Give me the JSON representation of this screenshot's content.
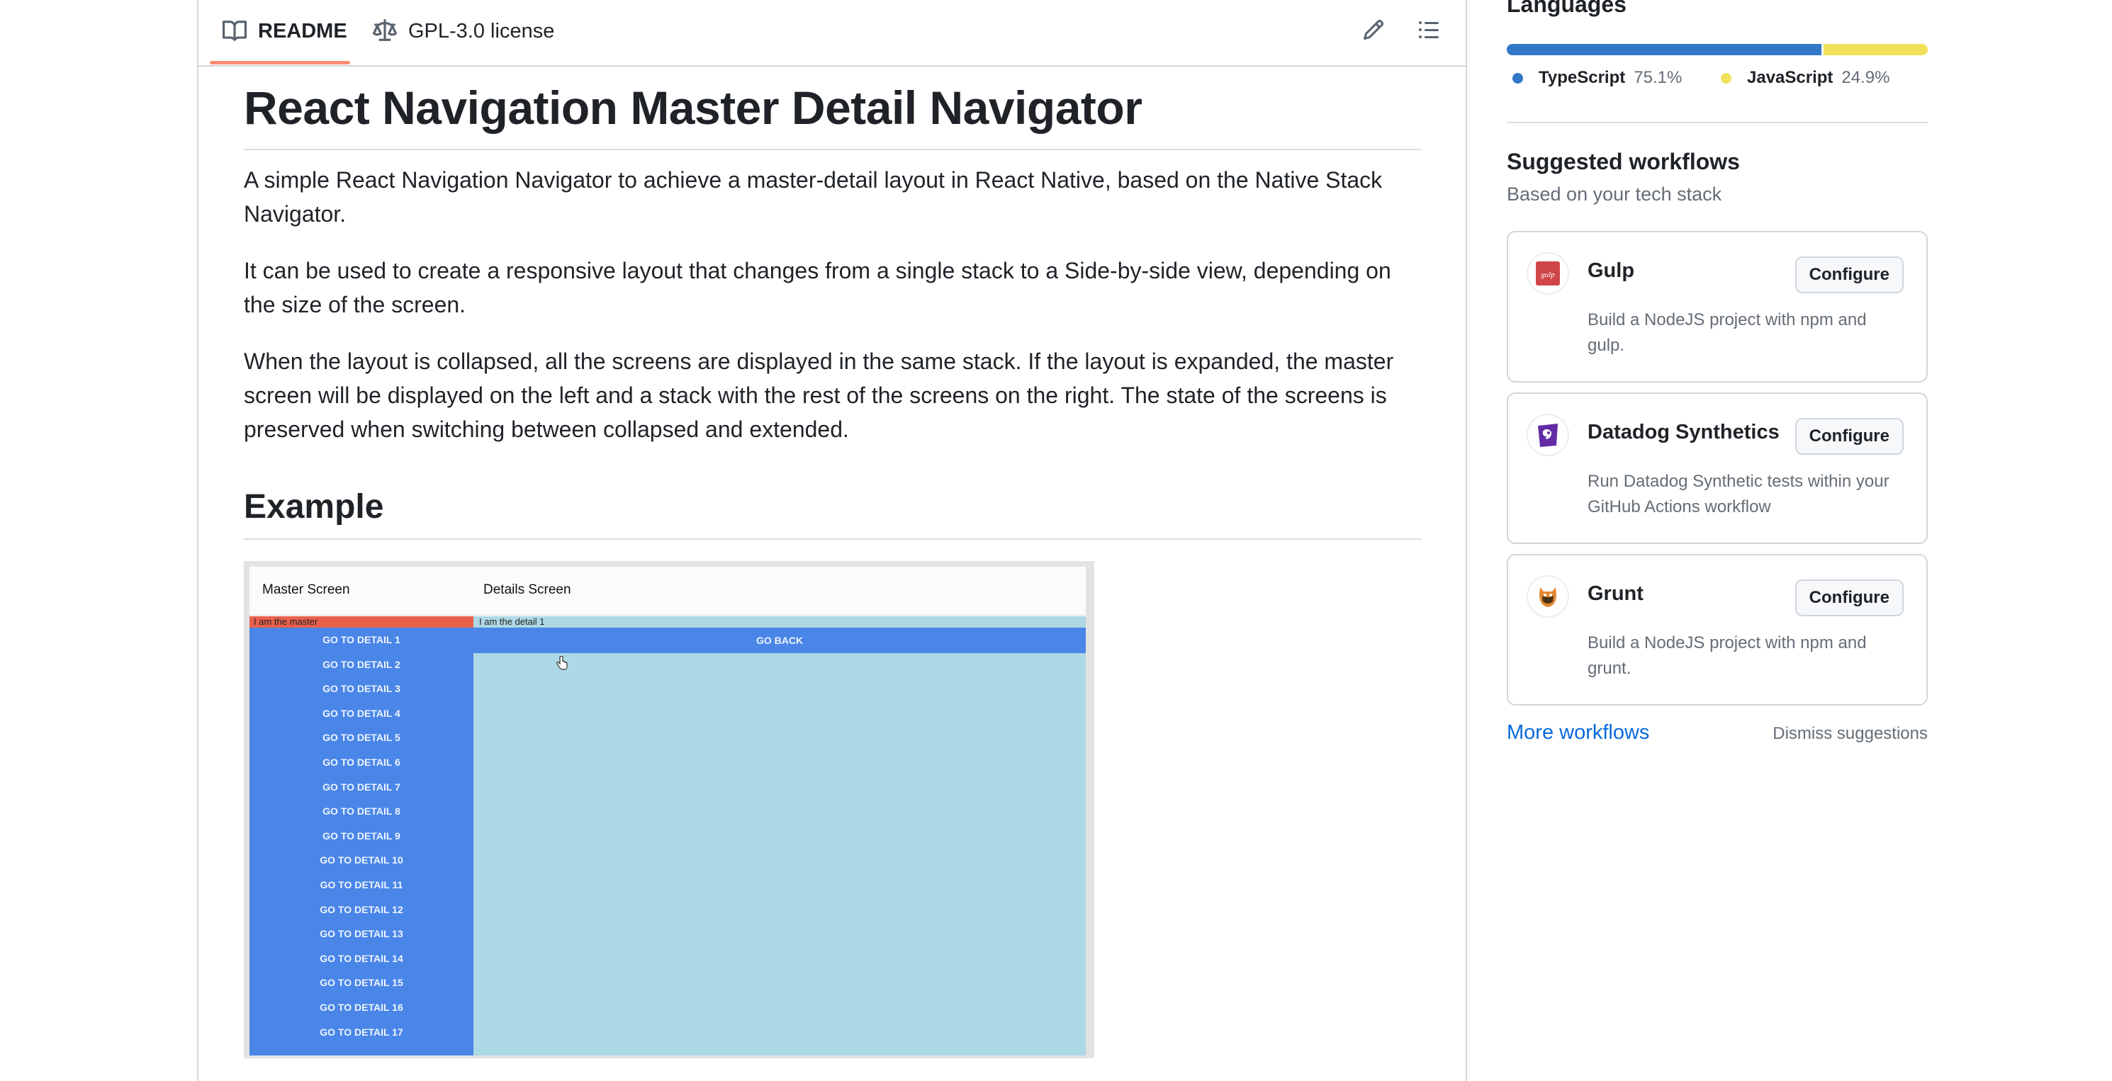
{
  "tabs": [
    {
      "label": "README",
      "icon": "book-icon",
      "active": true
    },
    {
      "label": "GPL-3.0 license",
      "icon": "scale-icon",
      "active": false
    }
  ],
  "toolbar": {
    "edit_icon": "pencil-icon",
    "toc_icon": "list-icon"
  },
  "readme": {
    "title": "React Navigation Master Detail Navigator",
    "paragraphs": [
      "A simple React Navigation Navigator to achieve a master-detail layout in React Native, based on the Native Stack Navigator.",
      "It can be used to create a responsive layout that changes from a single stack to a Side-by-side view, depending on the size of the screen.",
      "When the layout is collapsed, all the screens are displayed in the same stack. If the layout is expanded, the master screen will be displayed on the left and a stack with the rest of the screens on the right. The state of the screens is preserved when switching between collapsed and extended."
    ],
    "example_heading": "Example",
    "demo": {
      "master_header": "Master Screen",
      "details_header": "Details Screen",
      "master_label": "I am the master",
      "detail_label": "I am the detail 1",
      "go_back": "GO BACK",
      "buttons": [
        "GO TO DETAIL 1",
        "GO TO DETAIL 2",
        "GO TO DETAIL 3",
        "GO TO DETAIL 4",
        "GO TO DETAIL 5",
        "GO TO DETAIL 6",
        "GO TO DETAIL 7",
        "GO TO DETAIL 8",
        "GO TO DETAIL 9",
        "GO TO DETAIL 10",
        "GO TO DETAIL 11",
        "GO TO DETAIL 12",
        "GO TO DETAIL 13",
        "GO TO DETAIL 14",
        "GO TO DETAIL 15",
        "GO TO DETAIL 16",
        "GO TO DETAIL 17"
      ]
    }
  },
  "sidebar": {
    "languages_title": "Languages",
    "languages": [
      {
        "name": "TypeScript",
        "percent": "75.1%",
        "share": 0.751,
        "color": "#3178c6"
      },
      {
        "name": "JavaScript",
        "percent": "24.9%",
        "share": 0.249,
        "color": "#f1e05a"
      }
    ],
    "workflows_title": "Suggested workflows",
    "workflows_subtitle": "Based on your tech stack",
    "workflows": [
      {
        "name": "Gulp",
        "desc": "Build a NodeJS project with npm and gulp.",
        "button": "Configure",
        "icon": "gulp-logo-icon"
      },
      {
        "name": "Datadog Synthetics",
        "desc": "Run Datadog Synthetic tests within your GitHub Actions workflow",
        "button": "Configure",
        "icon": "datadog-logo-icon"
      },
      {
        "name": "Grunt",
        "desc": "Build a NodeJS project with npm and grunt.",
        "button": "Configure",
        "icon": "grunt-logo-icon"
      }
    ],
    "more_workflows": "More workflows",
    "dismiss": "Dismiss suggestions"
  }
}
